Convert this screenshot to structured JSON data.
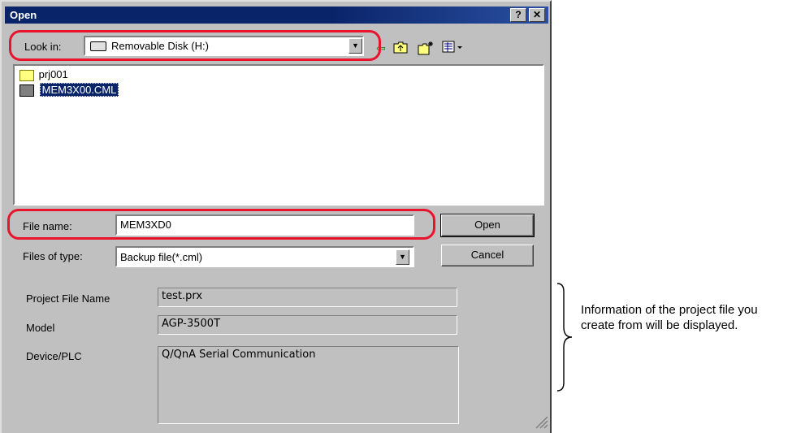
{
  "dialog": {
    "title": "Open",
    "help_button": "?",
    "close_button": "✕"
  },
  "look_in": {
    "label": "Look in:",
    "value": "Removable Disk (H:)",
    "drive_icon": "removable-disk-icon"
  },
  "toolbar": {
    "icons": [
      "back-arrow-icon",
      "up-folder-icon",
      "new-folder-icon",
      "view-menu-icon"
    ]
  },
  "files": [
    {
      "name": "prj001",
      "icon": "folder-icon",
      "selected": false
    },
    {
      "name": "MEM3X00.CML",
      "icon": "cml-file-icon",
      "selected": true
    }
  ],
  "file_name": {
    "label": "File name:",
    "value": "MEM3XD0"
  },
  "files_of_type": {
    "label": "Files of type:",
    "value": "Backup file(*.cml)"
  },
  "buttons": {
    "open": "Open",
    "cancel": "Cancel"
  },
  "info": {
    "project_file_name_label": "Project File Name",
    "project_file_name_value": "test.prx",
    "model_label": "Model",
    "model_value": "AGP-3500T",
    "device_label": "Device/PLC",
    "device_value": "Q/QnA Serial Communication"
  },
  "annotation": {
    "text": "Information of the project file you create from will be displayed."
  },
  "colors": {
    "highlight": "#e8142c",
    "titlebar": "#0a246a",
    "dialog_bg": "#c0c0c0"
  }
}
